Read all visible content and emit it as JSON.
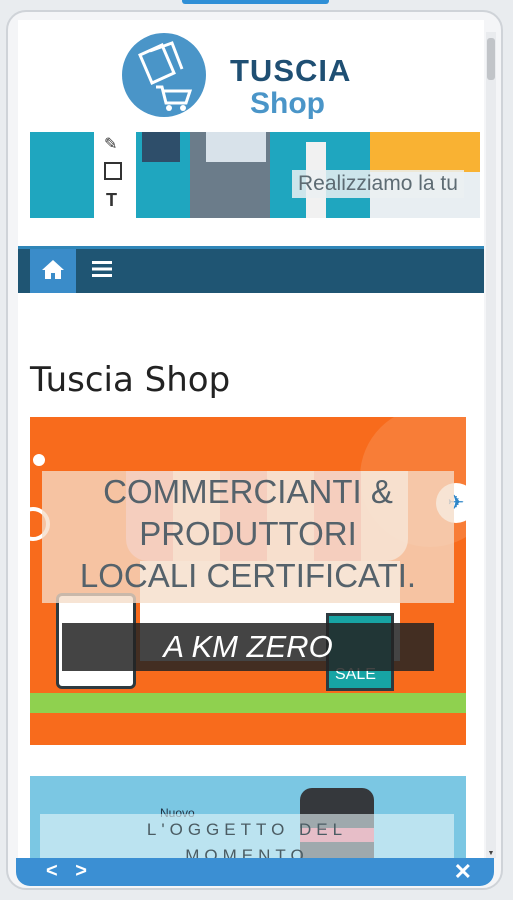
{
  "header": {
    "logo_line1": "TUSCIA",
    "logo_line2": "Shop"
  },
  "banner": {
    "text": "Realizziamo la tu"
  },
  "nav": {
    "home_icon": "home-icon",
    "menu_icon": "hamburger-menu-icon"
  },
  "page": {
    "title": "Tuscia Shop"
  },
  "slide1": {
    "lines": [
      "COMMERCIANTI &",
      "PRODUTTORI",
      "LOCALI CERTIFICATI."
    ],
    "badge": "A KM ZERO",
    "sale_label": "SALE"
  },
  "slide2": {
    "tag": "Nuovo",
    "lines": [
      "L'OGGETTO DEL",
      "MOMENTO"
    ]
  },
  "toolbar": {
    "arrows": "< >",
    "close": "✕"
  },
  "colors": {
    "nav_bar": "#1f5573",
    "accent": "#3a8cc9",
    "slide1_bg": "#f86b1c",
    "slide2_bg": "#7bc7e3"
  }
}
